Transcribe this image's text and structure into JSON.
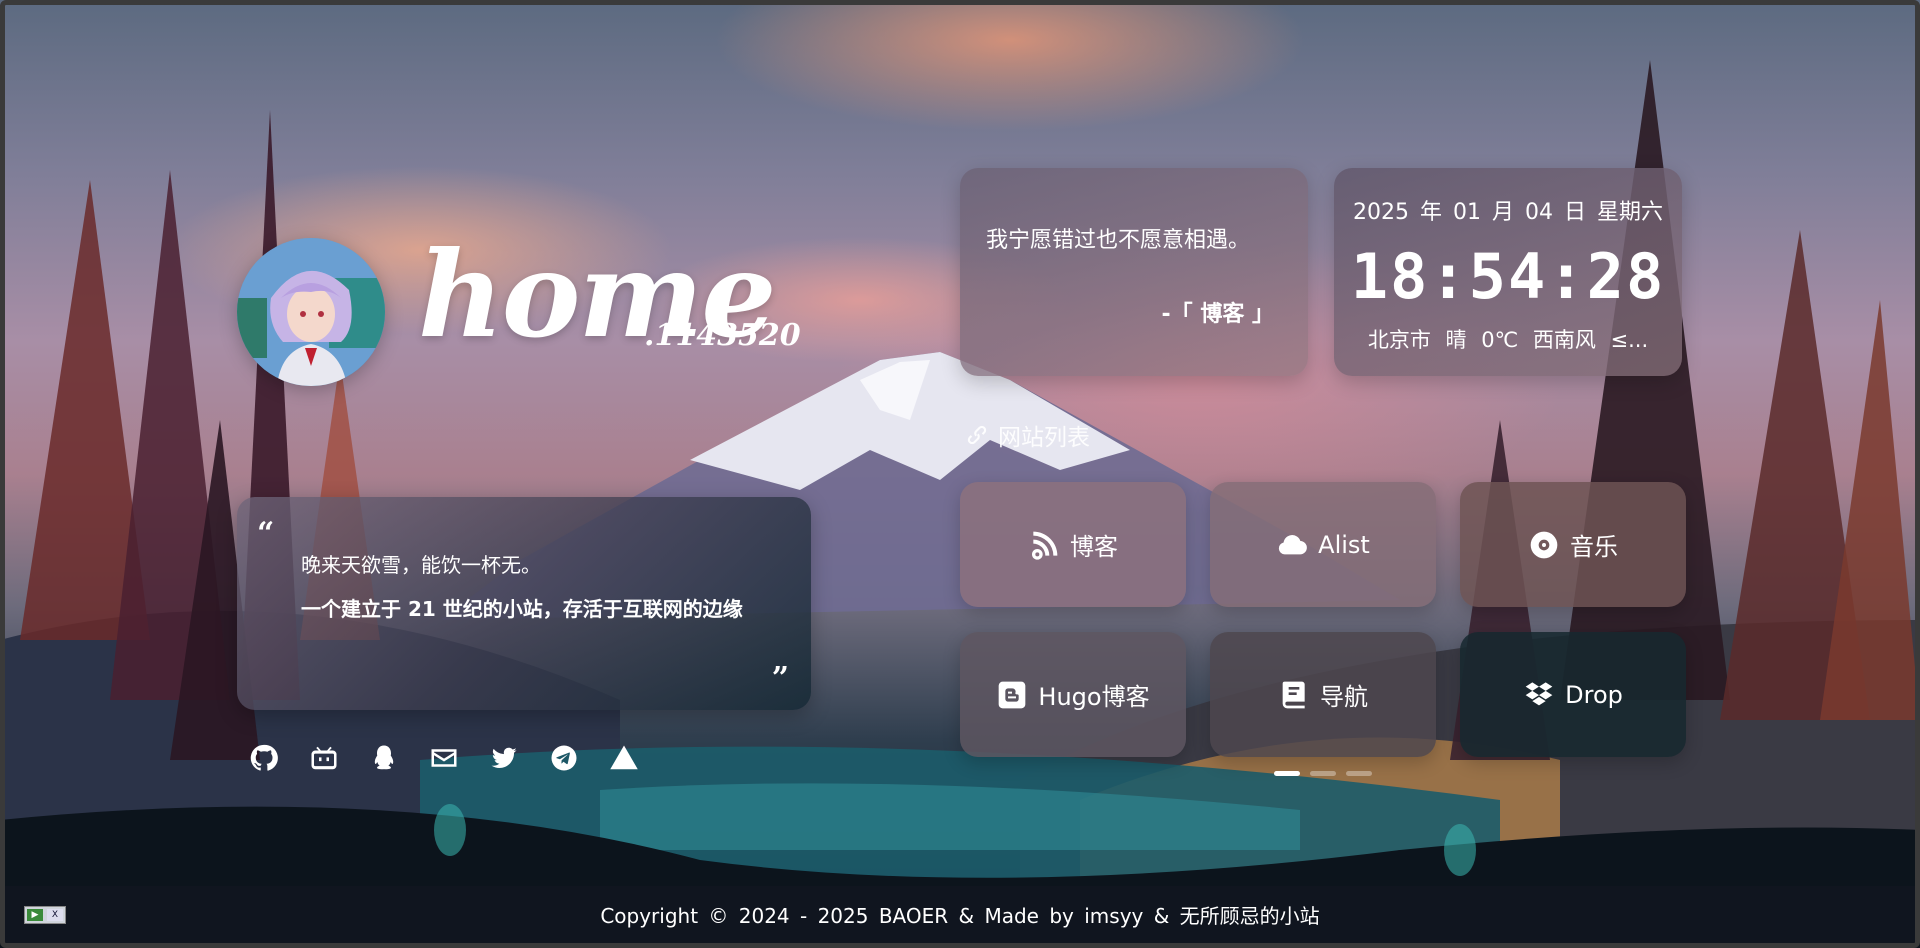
{
  "site": {
    "logo_main": "home",
    "logo_sub": ".1143520"
  },
  "quote": {
    "open_mark": "“",
    "close_mark": "”",
    "line1": "晚来天欲雪，能饮一杯无。",
    "line2": "一个建立于 21 世纪的小站，存活于互联网的边缘"
  },
  "social_links": [
    {
      "name": "github-icon"
    },
    {
      "name": "bilibili-icon"
    },
    {
      "name": "qq-icon"
    },
    {
      "name": "email-icon"
    },
    {
      "name": "twitter-icon"
    },
    {
      "name": "telegram-icon"
    },
    {
      "name": "triangle-icon"
    }
  ],
  "hitokoto": {
    "text": "我宁愿错过也不愿意相遇。",
    "from": "-「 博客 」"
  },
  "clock": {
    "date": "2025 年 01 月 04 日 星期六",
    "time": "18:54:28",
    "weather": "北京市 晴 0℃ 西南风 ≤..."
  },
  "sites_section": {
    "title": "网站列表",
    "icon": "link-icon"
  },
  "site_tiles": [
    {
      "label": "博客",
      "icon": "blog-feed-icon"
    },
    {
      "label": "Alist",
      "icon": "cloud-icon"
    },
    {
      "label": "音乐",
      "icon": "music-disc-icon"
    },
    {
      "label": "Hugo博客",
      "icon": "blogger-icon"
    },
    {
      "label": "导航",
      "icon": "book-icon"
    },
    {
      "label": "Drop",
      "icon": "dropbox-icon"
    }
  ],
  "pager": {
    "pages": 3,
    "active": 1
  },
  "footer": {
    "text": "Copyright © 2024 - 2025 BAOER & Made by imsyy & 无所顾忌的小站"
  },
  "colors": {
    "card_tint": "#6c6276",
    "footer_bg": "#121620",
    "text": "#ffffff"
  }
}
